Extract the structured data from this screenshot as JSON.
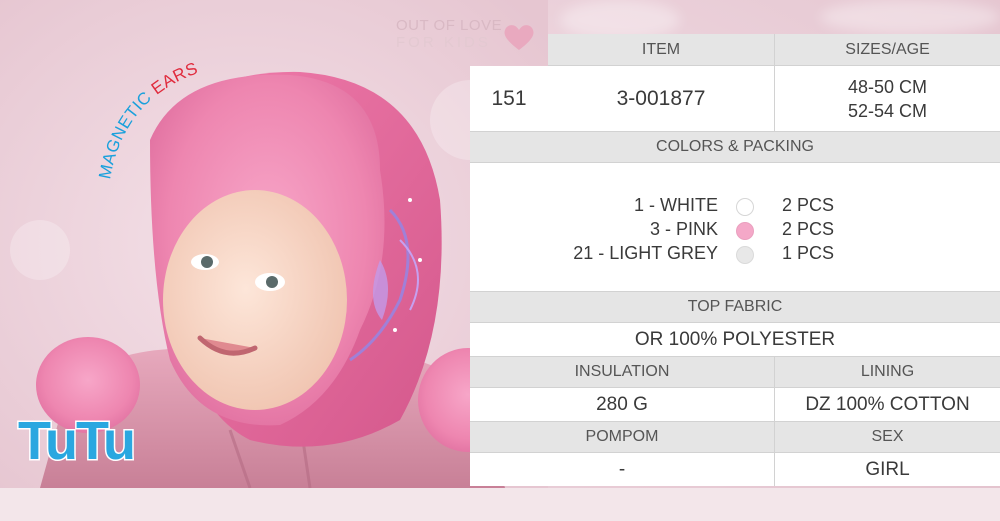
{
  "brand": {
    "line1": "OUT OF LOVE",
    "line2": "FOR KIDS",
    "heart_icon": "heart-icon",
    "color": "#e8b4c6"
  },
  "promo": {
    "magnetic_text": "MAGNETIC",
    "ears_text": "EARS",
    "magnetic_color": "#1aa0dc",
    "ears_color": "#e02a3c"
  },
  "logo": {
    "text": "TuTu",
    "fill": "#2aa7e0",
    "outline": "#ffffff"
  },
  "product": {
    "headers": {
      "item": "ITEM",
      "sizes": "SIZES/AGE"
    },
    "number": "151",
    "item_code": "3-001877",
    "sizes": [
      "48-50 CM",
      "52-54 CM"
    ]
  },
  "colors_packing": {
    "header": "COLORS & PACKING",
    "colors": [
      {
        "name": "1 - WHITE",
        "swatch": "#ffffff",
        "pcs": "2 PCS"
      },
      {
        "name": "3 - PINK",
        "swatch": "#f4a8c8",
        "pcs": "2 PCS"
      },
      {
        "name": "21 - LIGHT GREY",
        "swatch": "#e8e8e8",
        "pcs": "1 PCS"
      }
    ]
  },
  "top_fabric": {
    "header": "TOP FABRIC",
    "value": "OR 100% POLYESTER"
  },
  "insulation": {
    "header": "INSULATION",
    "value": "280 G"
  },
  "lining": {
    "header": "LINING",
    "value": "DZ 100% COTTON"
  },
  "pompom": {
    "header": "POMPOM",
    "value": "-"
  },
  "sex": {
    "header": "SEX",
    "value": "GIRL"
  }
}
